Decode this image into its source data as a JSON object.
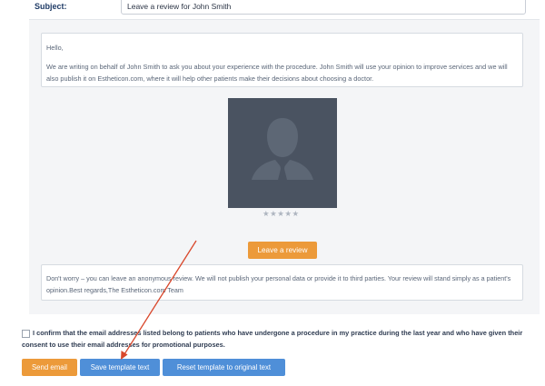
{
  "subject": {
    "label": "Subject:",
    "value": "Leave a review for John Smith"
  },
  "message": {
    "greeting": "Hello,",
    "body": "We are writing on behalf of John Smith to ask you about your experience with the procedure. John Smith will use your opinion to improve services and we will also publish it on Estheticon.com, where it will help other patients make their decisions about choosing a doctor."
  },
  "rating": {
    "stars": "★★★★★",
    "value": 0,
    "max": 5
  },
  "review_button": {
    "label": "Leave a review"
  },
  "note": {
    "text": "Don't worry – you can leave an anonymous review. We will not publish your personal data or provide it to third parties. Your review will stand simply as a patient's opinion.Best regards,The Estheticon.com Team"
  },
  "confirm": {
    "checked": false,
    "label": "I confirm that the email addresses listed belong to patients who have undergone a procedure in my practice during the last year and who have given their consent to use their email addresses for promotional purposes."
  },
  "actions": {
    "send": "Send email",
    "save": "Save template text",
    "reset": "Reset template to original text"
  },
  "colors": {
    "orange": "#ec9a3a",
    "blue": "#4f8fd8",
    "arrow": "#d9472b"
  }
}
